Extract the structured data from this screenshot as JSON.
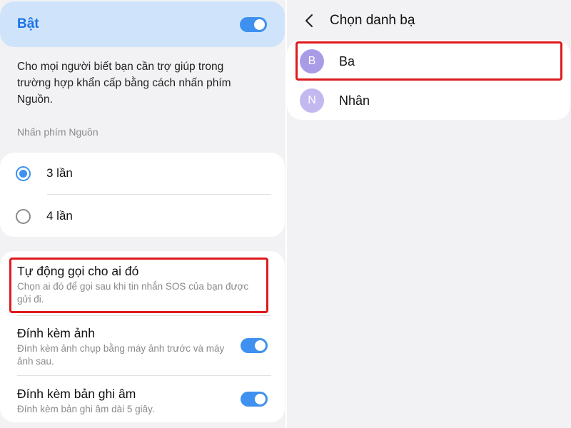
{
  "left": {
    "master": {
      "label": "Bật",
      "enabled": true
    },
    "description": "Cho mọi người biết bạn cần trợ giúp trong trường hợp khẩn cấp bằng cách nhấn phím Nguồn.",
    "press_section": {
      "title": "Nhấn phím Nguồn",
      "options": [
        {
          "label": "3 lần",
          "selected": true
        },
        {
          "label": "4 lần",
          "selected": false
        }
      ]
    },
    "options": [
      {
        "title": "Tự động gọi cho ai đó",
        "subtitle": "Chọn ai đó để gọi sau khi tin nhắn SOS của bạn được gửi đi."
      },
      {
        "title": "Đính kèm ảnh",
        "subtitle": "Đính kèm ảnh chụp bằng máy ảnh trước và máy ảnh sau.",
        "enabled": true
      },
      {
        "title": "Đính kèm bản ghi âm",
        "subtitle": "Đính kèm bản ghi âm dài 5 giây.",
        "enabled": true
      }
    ]
  },
  "right": {
    "title": "Chọn danh bạ",
    "back_icon": "chevron-left-icon",
    "contacts": [
      {
        "initial": "B",
        "name": "Ba",
        "color": "#a99be6"
      },
      {
        "initial": "N",
        "name": "Nhân",
        "color": "#c3b8ef"
      }
    ]
  },
  "colors": {
    "accent": "#3e91f0",
    "master_bg": "#cfe4fb",
    "highlight": "#e0191e"
  }
}
